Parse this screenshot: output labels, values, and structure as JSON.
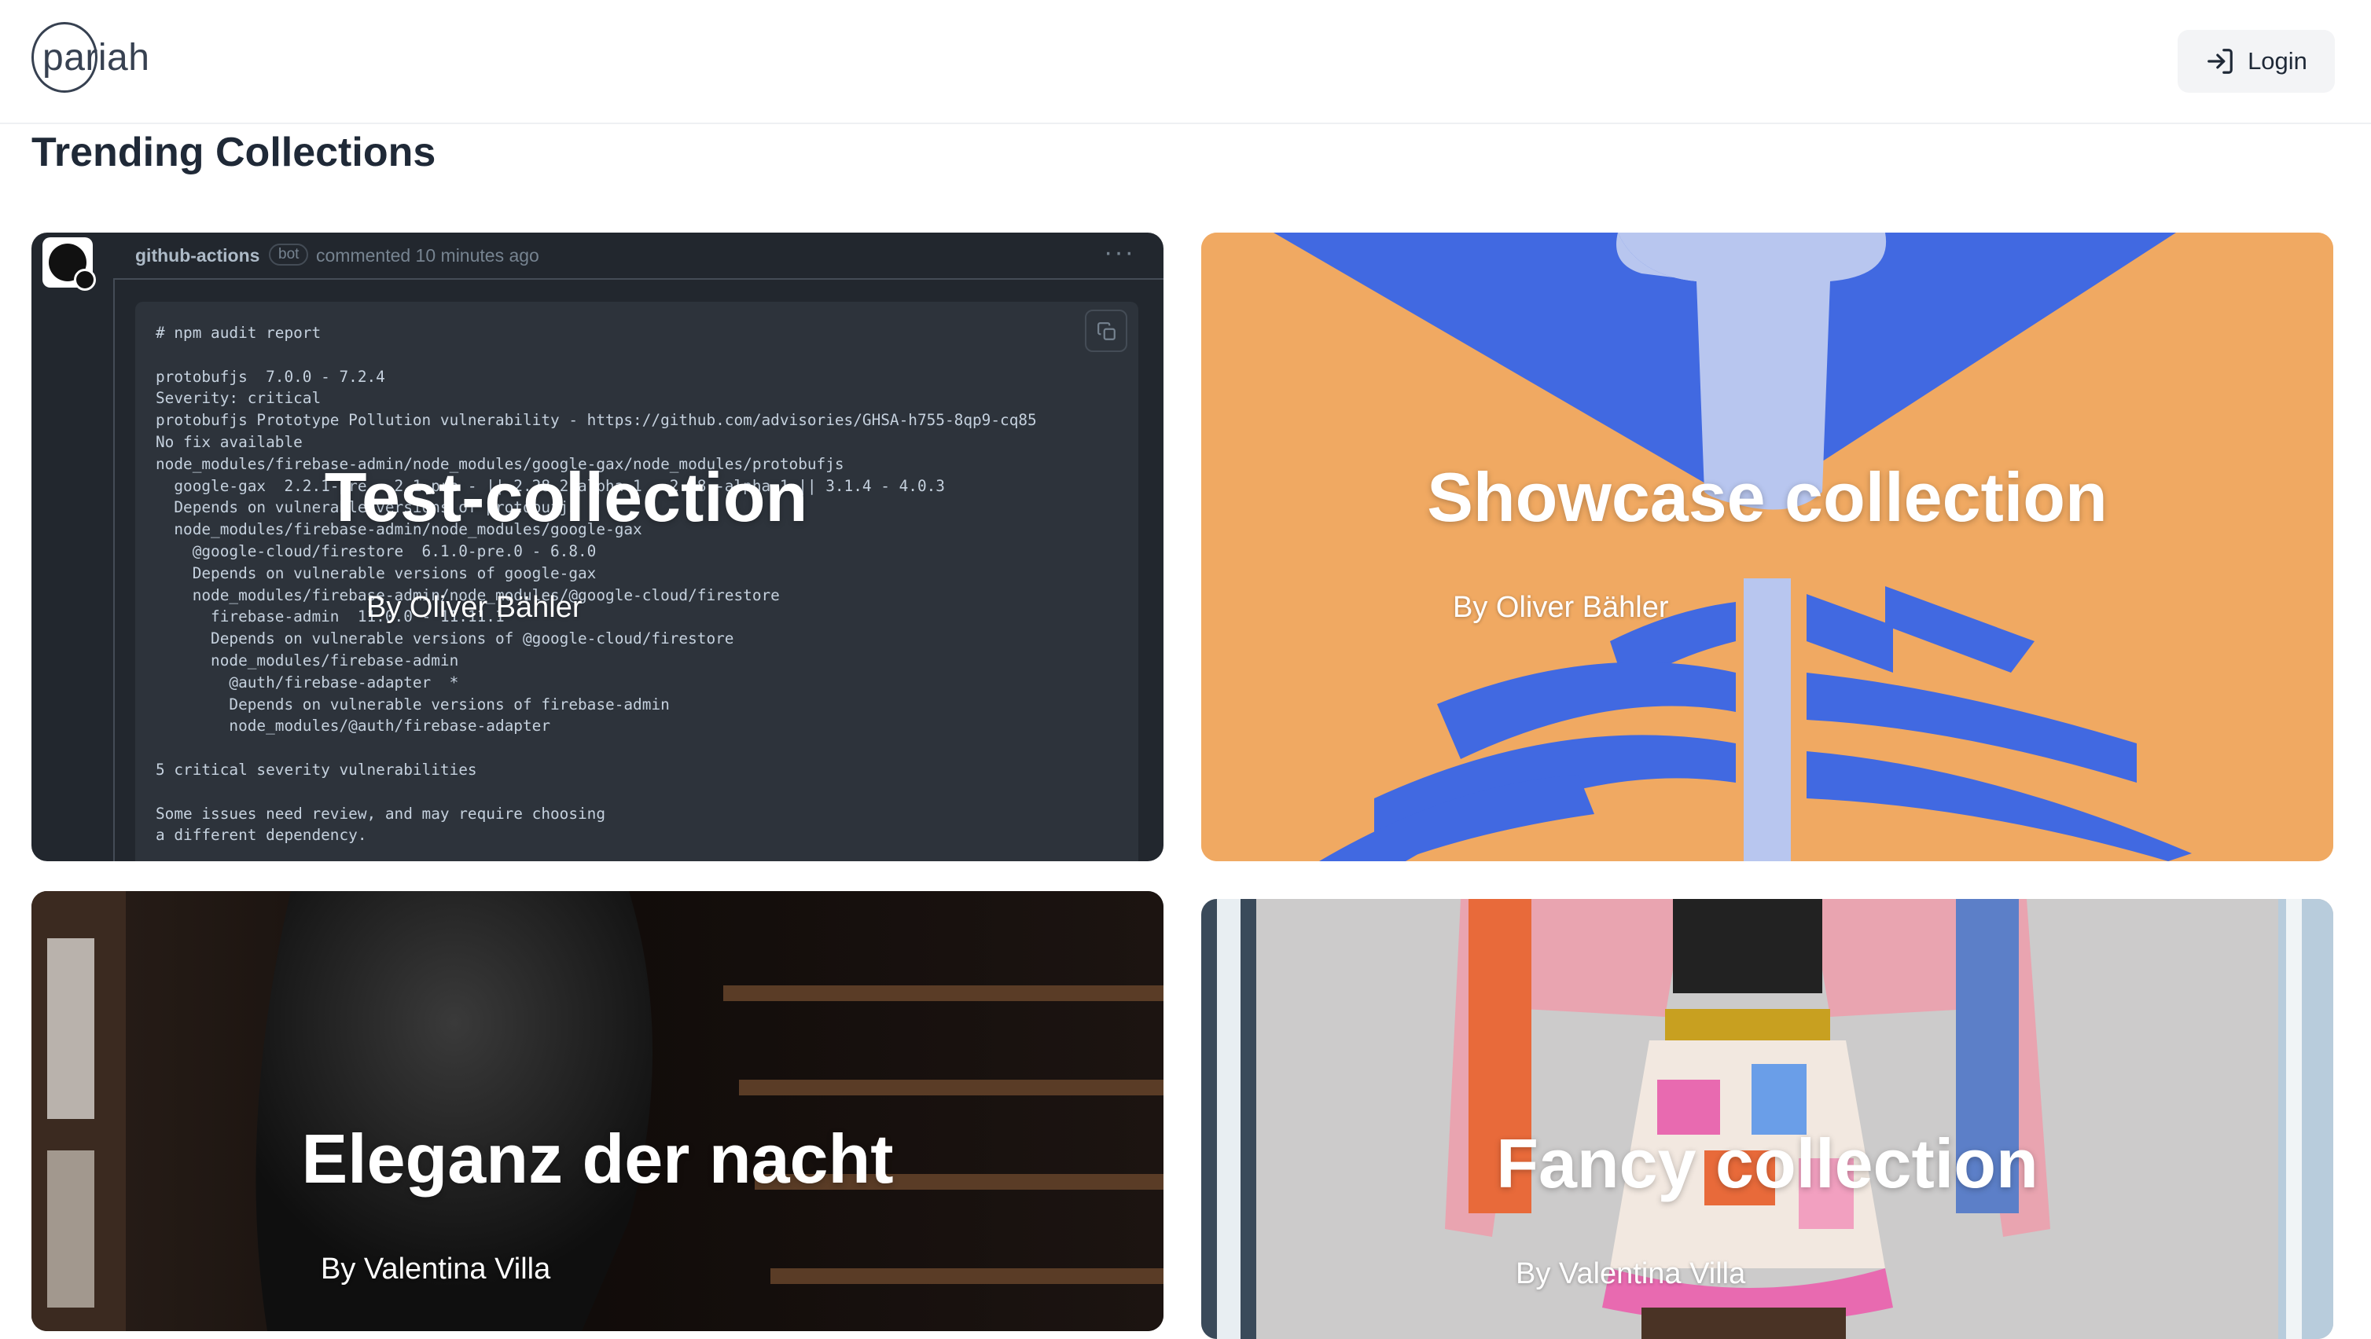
{
  "header": {
    "logo_text": "pariah",
    "login_label": "Login"
  },
  "section_title": "Trending Collections",
  "collections": [
    {
      "title": "Test-collection",
      "author": "By Oliver Bähler",
      "image": {
        "user": "github-actions",
        "bot_label": "bot",
        "comment_meta": "commented 10 minutes ago",
        "code_lines": [
          "# npm audit report",
          "",
          "protobufjs  7.0.0 - 7.2.4",
          "Severity: critical",
          "protobufjs Prototype Pollution vulnerability - https://github.com/advisories/GHSA-h755-8qp9-cq85",
          "No fix available",
          "node_modules/firebase-admin/node_modules/google-gax/node_modules/protobufjs",
          "  google-gax  2.2.1-pre - 2.1-pre - || 2.28.2-alpha.1 - 2.28 -alpha.1 || 3.1.4 - 4.0.3",
          "  Depends on vulnerable versions of protobufjs",
          "  node_modules/firebase-admin/node_modules/google-gax",
          "    @google-cloud/firestore  6.1.0-pre.0 - 6.8.0",
          "    Depends on vulnerable versions of google-gax",
          "    node_modules/firebase-admin/node_modules/@google-cloud/firestore",
          "      firebase-admin  11.0.0 - 11.11.1",
          "      Depends on vulnerable versions of @google-cloud/firestore",
          "      node_modules/firebase-admin",
          "        @auth/firebase-adapter  *",
          "        Depends on vulnerable versions of firebase-admin",
          "        node_modules/@auth/firebase-adapter",
          "",
          "5 critical severity vulnerabilities",
          "",
          "Some issues need review, and may require choosing",
          "a different dependency."
        ]
      }
    },
    {
      "title": "Showcase collection",
      "author": "By Oliver Bähler"
    },
    {
      "title": "Eleganz der nacht",
      "author": "By Valentina Villa"
    },
    {
      "title": "Fancy collection",
      "author": "By Valentina Villa"
    }
  ],
  "colors": {
    "illustration_orange": "#f0a962",
    "illustration_blue": "#4169e1",
    "illustration_light_blue": "#b8c6ef",
    "github_dark": "#22272e"
  },
  "icons": {
    "login": "login-arrow-icon",
    "copy": "copy-icon",
    "more": "more-horizontal-icon"
  }
}
